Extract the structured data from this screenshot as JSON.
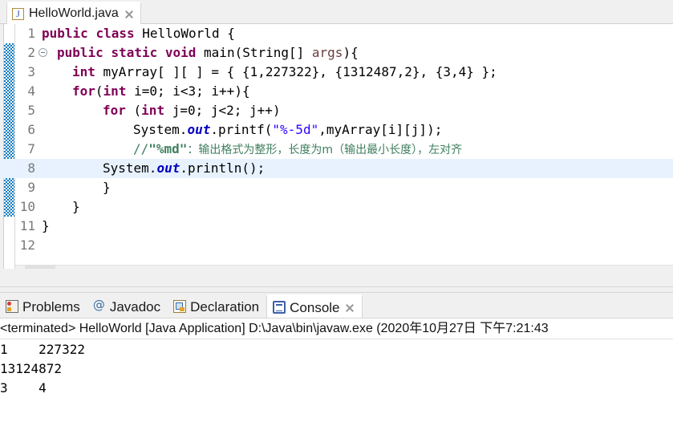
{
  "editor": {
    "tab": {
      "icon": "java-file-icon",
      "label": "HelloWorld.java",
      "close": "close-icon"
    },
    "gutter": {
      "fold_marker": "collapse-fold-icon"
    },
    "current_line": 8,
    "lines": [
      {
        "no": "1",
        "indent": 0,
        "text": "public class HelloWorld {"
      },
      {
        "no": "2",
        "indent": 1,
        "text": "public static void main(String[] args){"
      },
      {
        "no": "3",
        "indent": 2,
        "text": "int myArray[ ][ ] = { {1,227322}, {1312487,2}, {3,4} };"
      },
      {
        "no": "4",
        "indent": 2,
        "text": "for(int i=0; i<3; i++){"
      },
      {
        "no": "5",
        "indent": 3,
        "text": "for (int j=0; j<2; j++)"
      },
      {
        "no": "6",
        "indent": 4,
        "text": "System.out.printf(\"%-5d\",myArray[i][j]);"
      },
      {
        "no": "7",
        "indent": 3,
        "text": "//\"%md\"：输出格式为整形，长度为m（输出最小长度），左对齐"
      },
      {
        "no": "8",
        "indent": 3,
        "text": "System.out.println();"
      },
      {
        "no": "9",
        "indent": 2,
        "text": "}"
      },
      {
        "no": "10",
        "indent": 1,
        "text": "}"
      },
      {
        "no": "11",
        "indent": 0,
        "text": "}"
      },
      {
        "no": "12",
        "indent": 0,
        "text": ""
      }
    ],
    "tokens": {
      "l1_kw1": "public",
      "l1_kw2": "class",
      "l1_rest": " HelloWorld {",
      "l2_kw1": "public",
      "l2_kw2": "static",
      "l2_kw3": "void",
      "l2_mid": " main(String[] ",
      "l2_param": "args",
      "l2_end": "){",
      "l3_kw": "int",
      "l3_rest": " myArray[ ][ ] = { {1,227322}, {1312487,2}, {3,4} };",
      "l4_kw1": "for",
      "l4_a": "(",
      "l4_kw2": "int",
      "l4_rest": " i=0; i<3; i++){",
      "l5_kw1": "for",
      "l5_a": " (",
      "l5_kw2": "int",
      "l5_rest": " j=0; j<2; j++)",
      "l6_a": "System.",
      "l6_field": "out",
      "l6_b": ".printf(",
      "l6_str": "\"%-5d\"",
      "l6_c": ",myArray[i][j]);",
      "l7_a": "//",
      "l7_code": "\"%md\"",
      "l7_cjk": "：输出格式为整形，长度为m（输出最小长度），左对齐",
      "l8_a": "System.",
      "l8_field": "out",
      "l8_b": ".println();",
      "l9": "}",
      "l10": "}",
      "l11": "}"
    },
    "hscrollbar": {
      "left_arrow": "«"
    }
  },
  "bottom_views": {
    "tabs": [
      {
        "icon": "problems-icon",
        "label": "Problems",
        "active": false
      },
      {
        "icon": "javadoc-icon",
        "label": "Javadoc",
        "active": false
      },
      {
        "icon": "declaration-icon",
        "label": "Declaration",
        "active": false
      },
      {
        "icon": "console-icon",
        "label": "Console",
        "active": true
      }
    ],
    "close": "close-icon"
  },
  "console": {
    "status": "<terminated> HelloWorld [Java Application] D:\\Java\\bin\\javaw.exe  (2020年10月27日 下午7:21:43",
    "output": [
      "1    227322",
      "13124872",
      "3    4"
    ]
  },
  "colors": {
    "keyword": "#7f0055",
    "string": "#2a00ff",
    "comment": "#3f7f5f",
    "field": "#0000c0",
    "parameter": "#6a3e3e",
    "current_line_bg": "#e8f2fe",
    "change_bar": "#0a7ac4",
    "panel_bg": "#f0f0f0"
  }
}
